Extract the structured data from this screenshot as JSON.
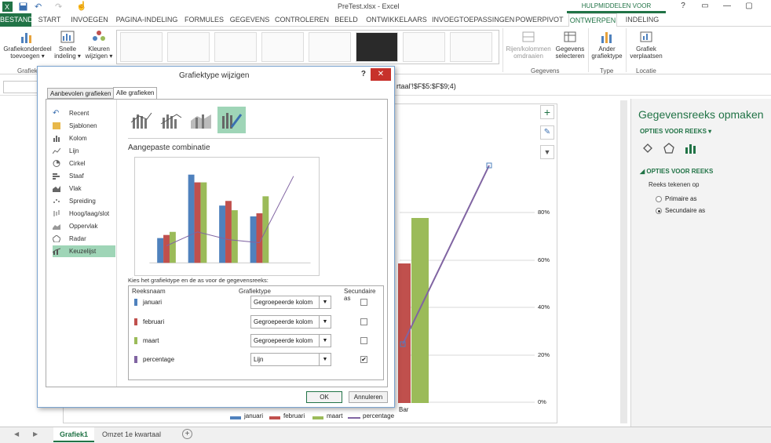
{
  "window": {
    "title": "PreTest.xlsx - Excel",
    "contextual_group": "HULPMIDDELEN VOOR GRAFIEKEN"
  },
  "tabs": [
    "BESTAND",
    "START",
    "INVOEGEN",
    "PAGINA-INDELING",
    "FORMULES",
    "GEGEVENS",
    "CONTROLEREN",
    "BEELD",
    "ONTWIKKELAARS",
    "INVOEGTOEPASSINGEN",
    "POWERPIVOT",
    "ONTWERPEN",
    "INDELING"
  ],
  "active_tab": "ONTWERPEN",
  "ribbon": {
    "add_element_1": "Grafiekonderdeel",
    "add_element_2": "toevoegen",
    "quick_layout_1": "Snelle",
    "quick_layout_2": "indeling",
    "colors_1": "Kleuren",
    "colors_2": "wijzigen",
    "switch_1": "Rijen/kolommen",
    "switch_2": "omdraaien",
    "select_data_1": "Gegevens",
    "select_data_2": "selecteren",
    "change_type_1": "Ander",
    "change_type_2": "grafiektype",
    "move_1": "Grafiek",
    "move_2": "verplaatsen",
    "group_chart_layouts": "Grafiek",
    "group_data": "Gegevens",
    "group_type": "Type",
    "group_location": "Locatie"
  },
  "formula_bar": {
    "text": "rtaal'!$F$5:$F$9;4)"
  },
  "chart": {
    "axis_right_ticks": [
      "80%",
      "60%",
      "40%",
      "20%",
      "0%"
    ],
    "category_label": "Bar",
    "legend": [
      "januari",
      "februari",
      "maart",
      "percentage"
    ]
  },
  "pane": {
    "title": "Gegevensreeks opmaken",
    "options_dropdown": "OPTIES VOOR REEKS",
    "section": "OPTIES VOOR REEKS",
    "plot_on_label": "Reeks tekenen op",
    "primary": "Primaire as",
    "secondary": "Secundaire as"
  },
  "sheet_tabs": [
    "Grafiek1",
    "Omzet 1e kwartaal"
  ],
  "dialog": {
    "title": "Grafiektype wijzigen",
    "help": "?",
    "close": "✕",
    "tab_recommended": "Aanbevolen grafieken",
    "tab_all": "Alle grafieken",
    "categories": [
      "Recent",
      "Sjablonen",
      "Kolom",
      "Lijn",
      "Cirkel",
      "Staaf",
      "Vlak",
      "Spreiding",
      "Hoog/laag/slot",
      "Oppervlak",
      "Radar",
      "Keuzelijst"
    ],
    "selected_category": "Keuzelijst",
    "combo_title": "Aangepaste combinatie",
    "instruction": "Kies het grafiektype en de as voor de gegevensreeks:",
    "col_series": "Reeksnaam",
    "col_type": "Grafiektype",
    "col_secondary": "Secundaire as",
    "series": [
      {
        "name": "januari",
        "type": "Gegroepeerde kolom",
        "secondary": false,
        "color": "#4f81bd"
      },
      {
        "name": "februari",
        "type": "Gegroepeerde kolom",
        "secondary": false,
        "color": "#c0504d"
      },
      {
        "name": "maart",
        "type": "Gegroepeerde kolom",
        "secondary": false,
        "color": "#9bbb59"
      },
      {
        "name": "percentage",
        "type": "Lijn",
        "secondary": true,
        "color": "#8064a2"
      }
    ],
    "ok": "OK",
    "cancel": "Annuleren"
  },
  "colors": {
    "excel_green": "#217346",
    "selection_green": "#9fd5b7",
    "close_red": "#c7312b"
  }
}
